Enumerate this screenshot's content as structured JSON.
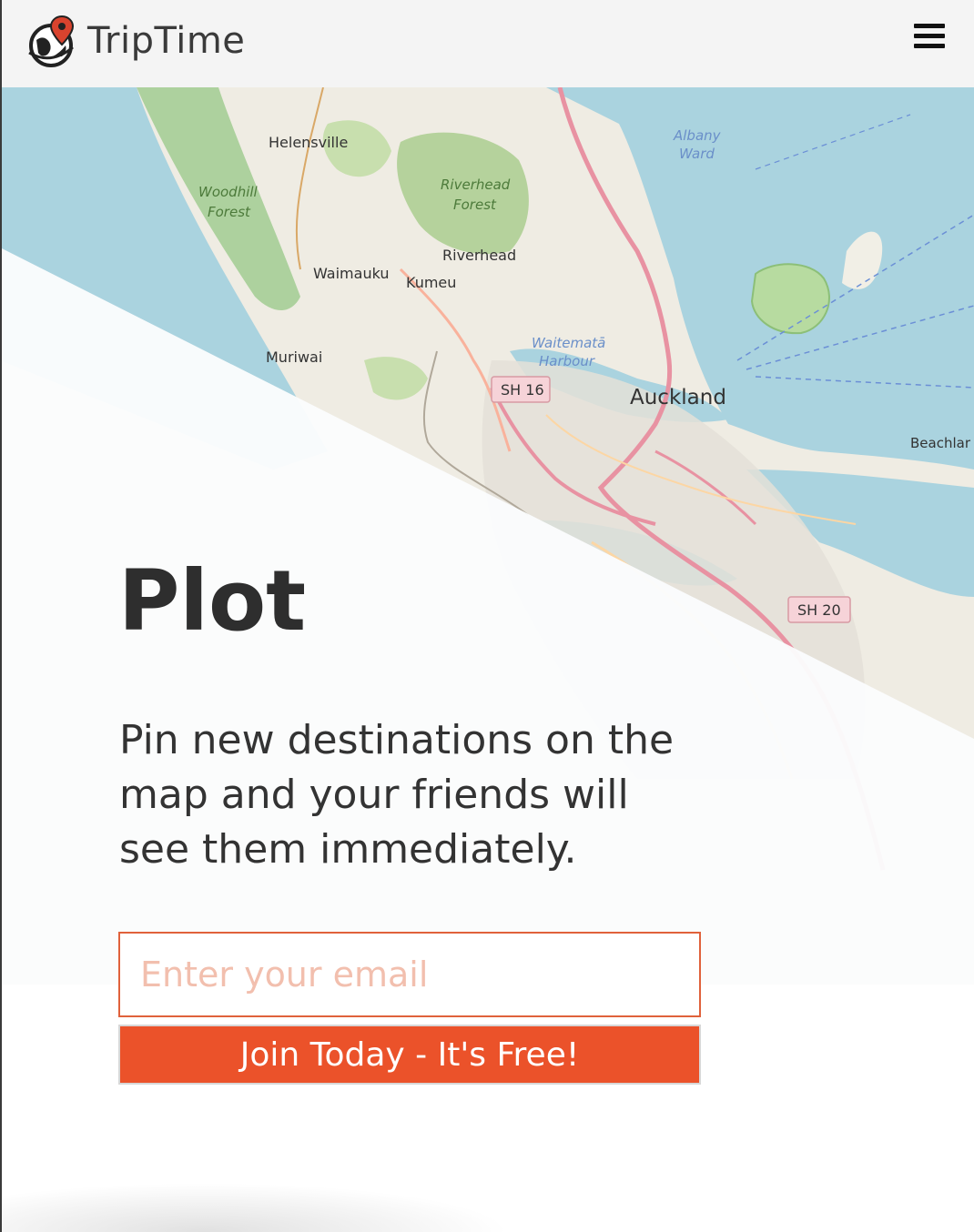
{
  "app": {
    "name": "TripTime"
  },
  "header": {
    "logo_icon": "globe-pin-icon",
    "menu_icon": "hamburger-menu-icon"
  },
  "colors": {
    "accent": "#eb522a",
    "input_border": "#e0613b",
    "header_bg": "#f4f4f4",
    "text": "#2e2e2e"
  },
  "map": {
    "labels": {
      "helensville": "Helensville",
      "albany_ward": [
        "Albany",
        "Ward"
      ],
      "woodhill_forest": [
        "Woodhill",
        "Forest"
      ],
      "riverhead_forest": [
        "Riverhead",
        "Forest"
      ],
      "riverhead": "Riverhead",
      "waimauku": "Waimauku",
      "kumeu": "Kumeu",
      "muriwai": "Muriwai",
      "waitemata_harbour": [
        "Waitematā",
        "Harbour"
      ],
      "auckland": "Auckland",
      "beachlands": "Beachlar",
      "sh16": "SH 16",
      "sh20": "SH 20"
    }
  },
  "hero": {
    "title": "Plot",
    "description": "Pin new destinations on the map and your friends will see them immediately.",
    "email_placeholder": "Enter your email",
    "cta_label": "Join Today - It's Free!"
  }
}
